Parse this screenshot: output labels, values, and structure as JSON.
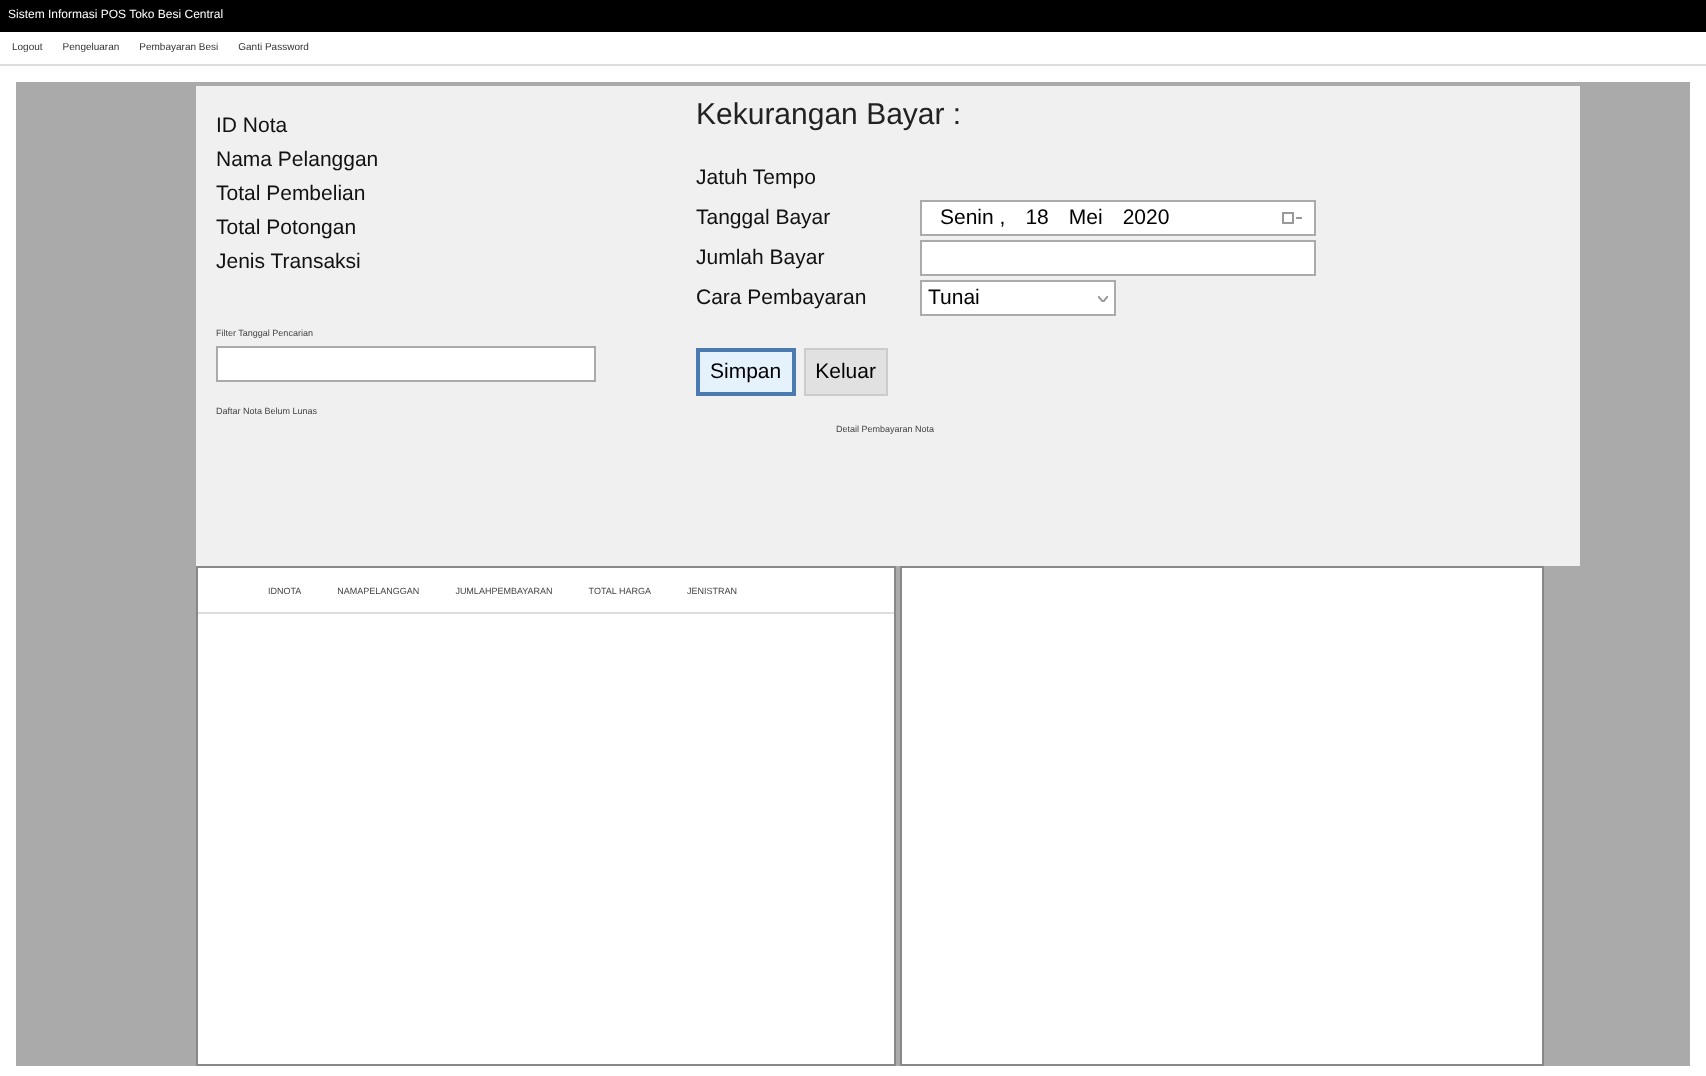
{
  "window": {
    "title": "Sistem Informasi POS Toko Besi Central"
  },
  "menu": [
    "Logout",
    "Pengeluaran",
    "Pembayaran Besi",
    "Ganti Password"
  ],
  "left_labels": [
    "ID Nota",
    "Nama Pelanggan",
    "Total Pembelian",
    "Total Potongan",
    "Jenis Transaksi"
  ],
  "filter": {
    "label": "Filter Tanggal Pencarian"
  },
  "heading": "Kekurangan Bayar :",
  "jatuh_tempo": "Jatuh Tempo",
  "tanggal_bayar": {
    "label": "Tanggal Bayar",
    "day": "Senin",
    "separator": ",",
    "date": "18",
    "month": "Mei",
    "year": "2020"
  },
  "jumlah_bayar": {
    "label": "Jumlah Bayar"
  },
  "cara_pembayaran": {
    "label": "Cara Pembayaran",
    "value": "Tunai"
  },
  "buttons": [
    {
      "label": "Simpan",
      "selected": true
    },
    {
      "label": "Keluar",
      "selected": false
    }
  ],
  "left_grid": {
    "caption": "Daftar Nota Belum Lunas",
    "columns": [
      "IDNOTA",
      "NAMAPELANGGAN",
      "JUMLAHPEMBAYARAN",
      "TOTAL HARGA",
      "JENISTRAN"
    ]
  },
  "right_grid": {
    "caption": "Detail Pembayaran Nota"
  }
}
